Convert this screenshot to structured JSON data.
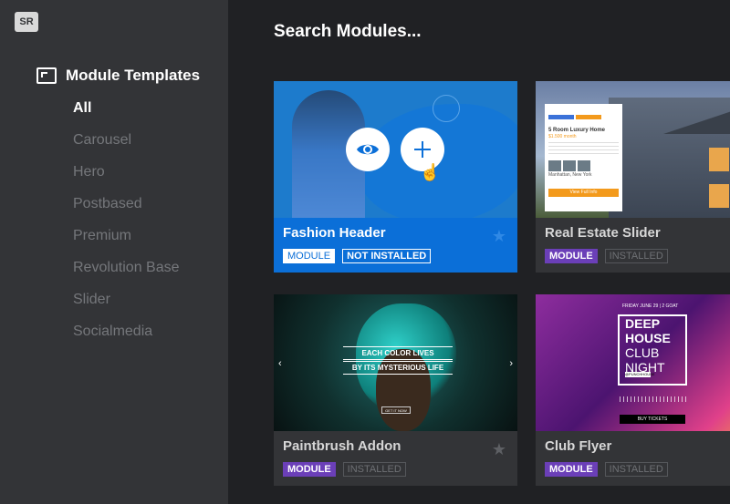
{
  "app": {
    "logo": "SR"
  },
  "sidebar": {
    "title": "Module Templates",
    "items": [
      {
        "label": "All",
        "active": true
      },
      {
        "label": "Carousel"
      },
      {
        "label": "Hero"
      },
      {
        "label": "Postbased"
      },
      {
        "label": "Premium"
      },
      {
        "label": "Revolution Base"
      },
      {
        "label": "Slider"
      },
      {
        "label": "Socialmedia"
      }
    ]
  },
  "search": {
    "placeholder": "Search Modules..."
  },
  "cards": [
    {
      "title": "Fashion Header",
      "type_badge": "MODULE",
      "status_badge": "NOT INSTALLED",
      "selected": true,
      "starred": true
    },
    {
      "title": "Real Estate Slider",
      "type_badge": "MODULE",
      "status_badge": "INSTALLED",
      "preview": {
        "card_title": "5 Room Luxury Home",
        "price": "$1.500 month",
        "location": "Manhattan, New York",
        "button": "View Full Info"
      }
    },
    {
      "title": "Paintbrush Addon",
      "type_badge": "MODULE",
      "status_badge": "INSTALLED",
      "preview": {
        "line1": "EACH COLOR LIVES",
        "line2": "BY ITS MYSTERIOUS LIFE",
        "button": "GET IT NOW"
      }
    },
    {
      "title": "Club Flyer",
      "type_badge": "MODULE",
      "status_badge": "INSTALLED",
      "preview": {
        "date": "FRIDAY JUNE 29 | 2 GOAT",
        "line1": "DEEP",
        "line2": "HOUSE",
        "line3": "CLUB",
        "line4": "NIGHT",
        "handle": "@PUNCHHOUSE",
        "button": "BUY TICKETS"
      }
    }
  ],
  "colors": {
    "accent": "#0b6fd8",
    "module_badge": "#6b3fb8",
    "sidebar_bg": "#333437",
    "page_bg": "#202124"
  }
}
